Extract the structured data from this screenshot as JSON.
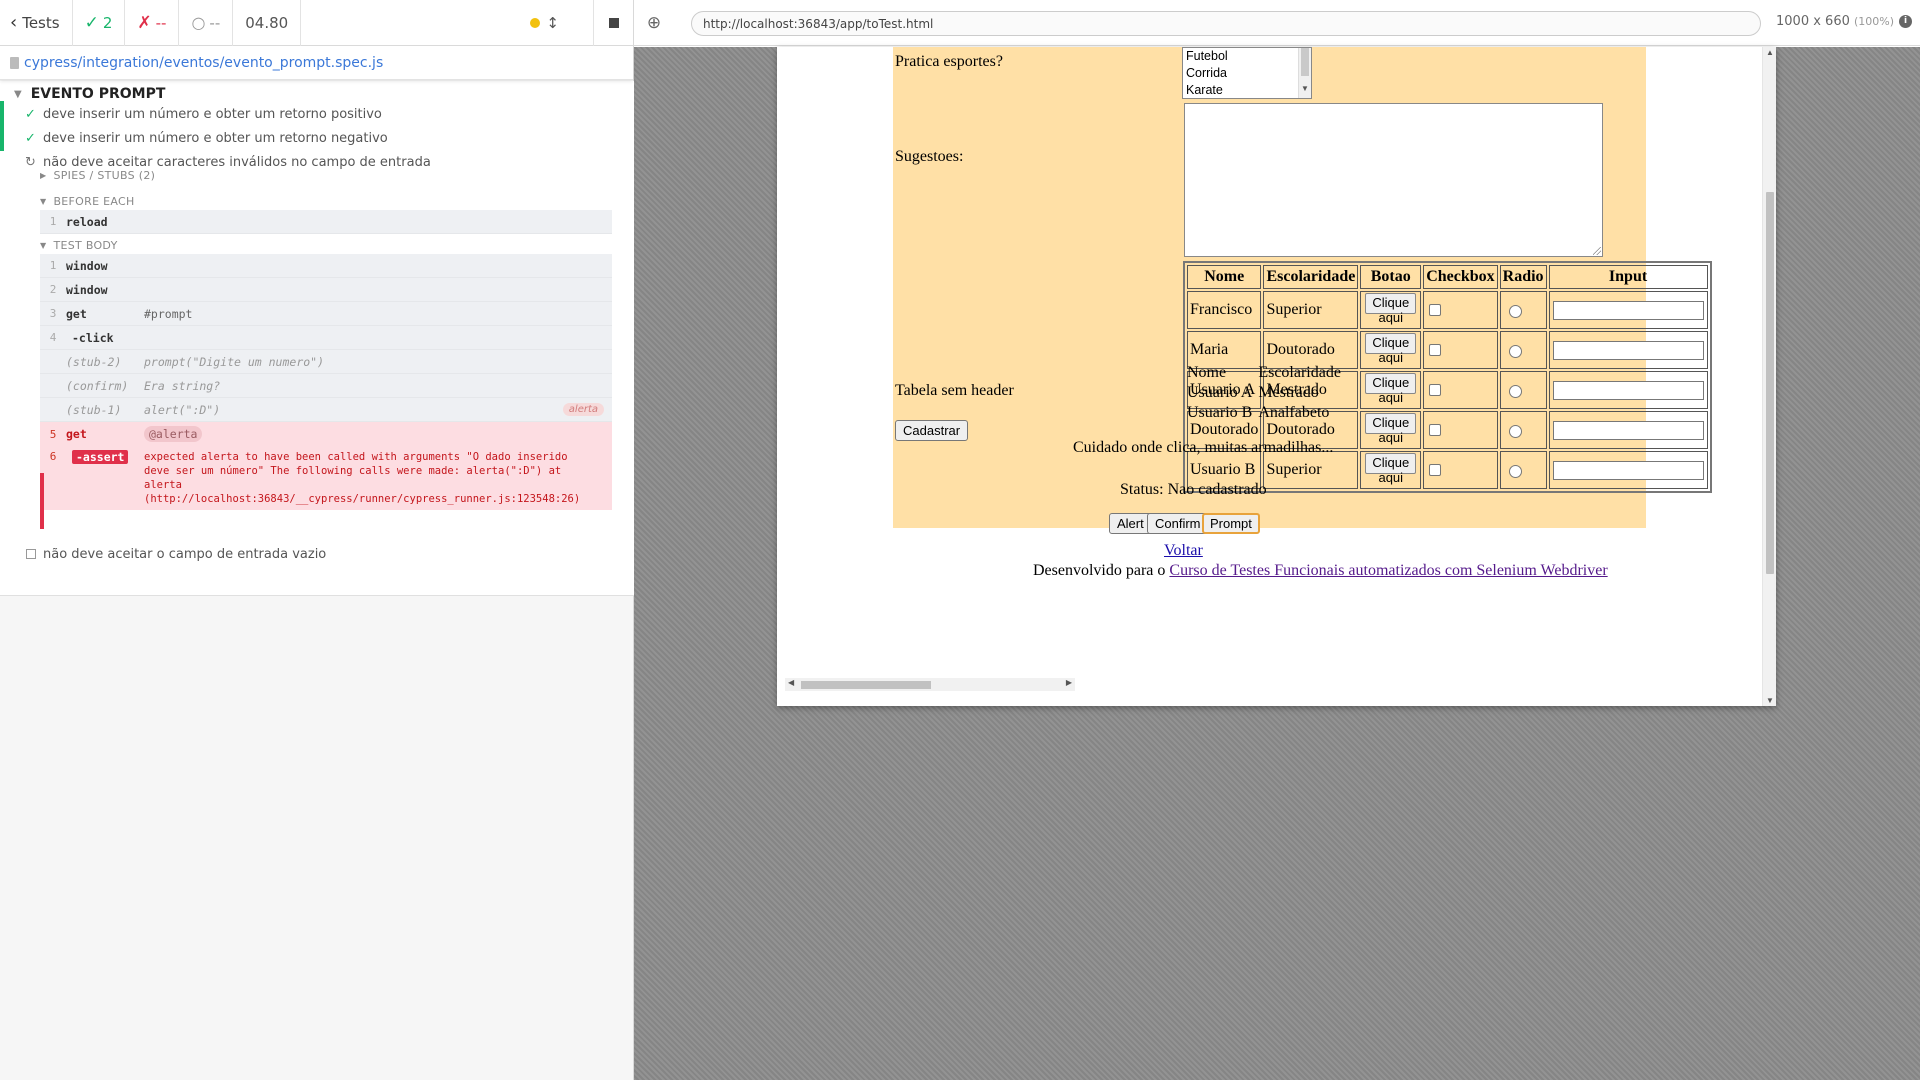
{
  "reporter": {
    "header": {
      "tests_label": "Tests",
      "passed_count": "2",
      "failed_count": "--",
      "pending_count": "--",
      "duration": "04.80"
    },
    "spec_path": "cypress/integration/eventos/evento_prompt.spec.js",
    "suite_title": "EVENTO PROMPT",
    "tests": [
      {
        "title": "deve inserir um número e obter um retorno positivo",
        "state": "passed"
      },
      {
        "title": "deve inserir um número e obter um retorno negativo",
        "state": "passed"
      },
      {
        "title": "não deve aceitar caracteres inválidos no campo de entrada",
        "state": "running"
      },
      {
        "title": "não deve aceitar o campo de entrada vazio",
        "state": "pending"
      }
    ],
    "spies_label": "SPIES / STUBS (2)",
    "before_each_label": "BEFORE EACH",
    "test_body_label": "TEST BODY",
    "before_each_commands": [
      {
        "num": "1",
        "name": "reload",
        "message": ""
      }
    ],
    "body_commands": [
      {
        "num": "1",
        "name": "window",
        "message": ""
      },
      {
        "num": "2",
        "name": "window",
        "message": ""
      },
      {
        "num": "3",
        "name": "get",
        "message": "#prompt"
      },
      {
        "num": "4",
        "name": "-click",
        "message": ""
      },
      {
        "num": "",
        "name": "(stub-2)",
        "message": "prompt(\"Digite um numero\")"
      },
      {
        "num": "",
        "name": "(confirm)",
        "message": "Era string?"
      },
      {
        "num": "",
        "name": "(stub-1)",
        "message": "alert(\":D\")",
        "badge": "alerta"
      },
      {
        "num": "5",
        "name": "get",
        "message": "@alerta"
      },
      {
        "num": "6",
        "name": "-assert",
        "message": "expected alerta to have been called with arguments \"O dado inserido deve ser um número\" The following calls were made: alerta(\":D\") at alerta (http://localhost:36843/__cypress/runner/cypress_runner.js:123548:26)"
      }
    ]
  },
  "aut": {
    "url": "http://localhost:36843/app/toTest.html",
    "viewport": "1000 x 660",
    "scale": "(100%)",
    "page": {
      "sports_label": "Pratica esportes?",
      "sports_options": [
        "Futebol",
        "Corrida",
        "Karate"
      ],
      "suggestions_label": "Sugestoes:",
      "table_headers": [
        "Nome",
        "Escolaridade",
        "Botao",
        "Checkbox",
        "Radio",
        "Input"
      ],
      "table_rows": [
        {
          "nome": "Francisco",
          "escolaridade": "Superior",
          "botao": "Clique aqui"
        },
        {
          "nome": "Maria",
          "escolaridade": "Doutorado",
          "botao": "Clique aqui"
        },
        {
          "nome": "Usuario A",
          "escolaridade": "Mestrado",
          "botao": "Clique aqui"
        },
        {
          "nome": "Doutorado",
          "escolaridade": "Doutorado",
          "botao": "Clique aqui"
        },
        {
          "nome": "Usuario B",
          "escolaridade": "Superior",
          "botao": "Clique aqui"
        }
      ],
      "table_no_header_label": "Tabela sem header",
      "table_no_header_rows": [
        [
          "Nome",
          "Escolaridade"
        ],
        [
          "Usuario A",
          "Mestrado"
        ],
        [
          "Usuario B",
          "Analfabeto"
        ]
      ],
      "submit_label": "Cadastrar",
      "warning_text": "Cuidado onde clica, muitas armadilhas...",
      "status_text": "Status: Nao cadastrado",
      "alert_label": "Alert",
      "confirm_label": "Confirm",
      "prompt_label": "Prompt",
      "back_link": "Voltar",
      "footer_prefix": "Desenvolvido para o",
      "footer_link": "Curso de Testes Funcionais automatizados com Selenium Webdriver"
    }
  },
  "colors": {
    "passed": "#18b56b",
    "failed": "#e0304a",
    "form_background": "#ffe0a6",
    "link": "#3b78d8"
  }
}
